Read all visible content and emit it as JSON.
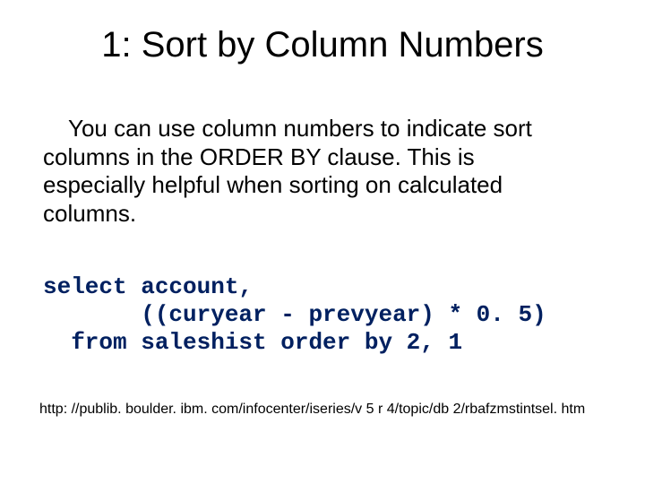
{
  "title": "1: Sort by Column Numbers",
  "body": "You can use column numbers to indicate sort columns in the ORDER BY clause. This is especially helpful when sorting on calculated columns.",
  "code": "select account,\n       ((curyear - prevyear) * 0. 5)\n  from saleshist order by 2, 1",
  "url": "http: //publib. boulder. ibm. com/infocenter/iseries/v 5 r 4/topic/db 2/rbafzmstintsel. htm"
}
